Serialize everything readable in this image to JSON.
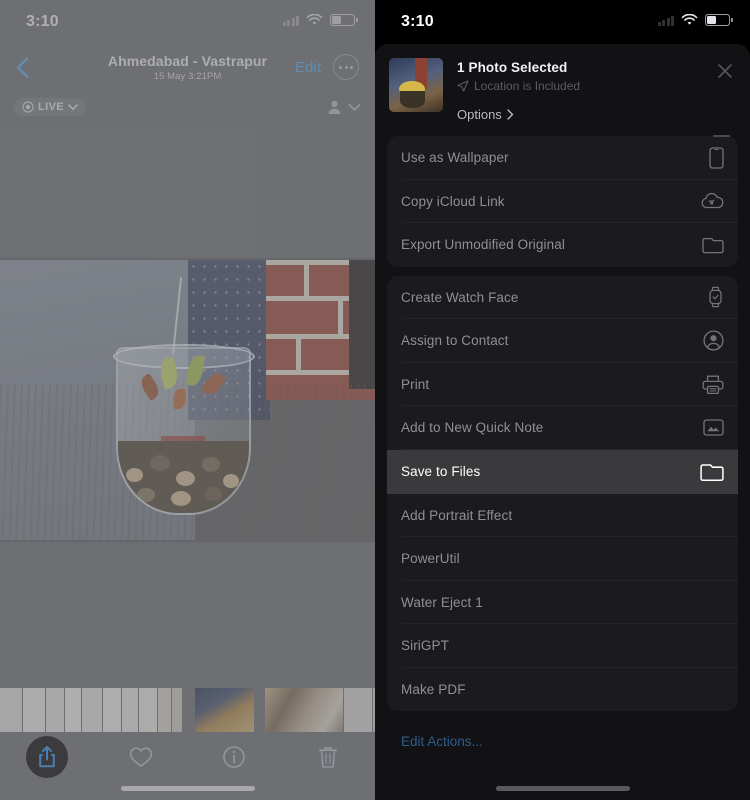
{
  "left_screen": {
    "status_bar": {
      "time": "3:10",
      "wifi_icon": "wifi-icon",
      "battery_icon": "battery-icon",
      "signal_icon": "signal-dots-icon"
    },
    "nav": {
      "back_icon": "chevron-left-icon",
      "title": "Ahmedabad - Vastrapur",
      "subtitle": "15 May  3:21PM",
      "edit_label": "Edit",
      "more_icon": "ellipsis-circle-icon"
    },
    "live_bar": {
      "live_label": "LIVE",
      "live_icon": "live-photo-icon",
      "chevron_icon": "chevron-down-icon",
      "people_icon": "person-icon",
      "people_chevron_icon": "chevron-down-icon"
    },
    "photo": {
      "alt_name": "succulent-in-glass-jar-photo"
    },
    "toolbar": {
      "share_icon": "share-icon",
      "favorite_icon": "heart-icon",
      "info_icon": "info-circle-icon",
      "delete_icon": "trash-icon"
    },
    "accent_color": "#5aa7e8"
  },
  "right_screen": {
    "status_bar": {
      "time": "3:10",
      "wifi_icon": "wifi-icon",
      "battery_icon": "battery-icon",
      "signal_icon": "signal-dots-icon"
    },
    "share_sheet": {
      "header": {
        "title": "1 Photo Selected",
        "location_text": "Location is Included",
        "location_icon": "location-arrow-icon",
        "options_label": "Options",
        "options_chevron_icon": "chevron-right-icon",
        "close_icon": "close-x-icon",
        "thumbnail_name": "selected-photo-thumbnail"
      },
      "groups": [
        {
          "items": [
            {
              "label": "Use as Wallpaper",
              "icon": "iphone-icon",
              "highlighted": false
            },
            {
              "label": "Copy iCloud Link",
              "icon": "icloud-link-icon",
              "highlighted": false
            },
            {
              "label": "Export Unmodified Original",
              "icon": "folder-icon",
              "highlighted": false
            }
          ]
        },
        {
          "items": [
            {
              "label": "Create Watch Face",
              "icon": "apple-watch-icon",
              "highlighted": false
            },
            {
              "label": "Assign to Contact",
              "icon": "contact-person-icon",
              "highlighted": false
            },
            {
              "label": "Print",
              "icon": "printer-icon",
              "highlighted": false
            },
            {
              "label": "Add to New Quick Note",
              "icon": "quick-note-icon",
              "highlighted": false
            },
            {
              "label": "Save to Files",
              "icon": "folder-icon",
              "highlighted": true
            },
            {
              "label": "Add Portrait Effect",
              "icon": "",
              "highlighted": false
            },
            {
              "label": "PowerUtil",
              "icon": "",
              "highlighted": false
            },
            {
              "label": "Water Eject 1",
              "icon": "",
              "highlighted": false
            },
            {
              "label": "SiriGPT",
              "icon": "",
              "highlighted": false
            },
            {
              "label": "Make PDF",
              "icon": "",
              "highlighted": false
            }
          ]
        }
      ],
      "edit_actions_label": "Edit Actions...",
      "highlight_color": "#3a3a3c",
      "link_color": "#2f5d8c"
    }
  }
}
